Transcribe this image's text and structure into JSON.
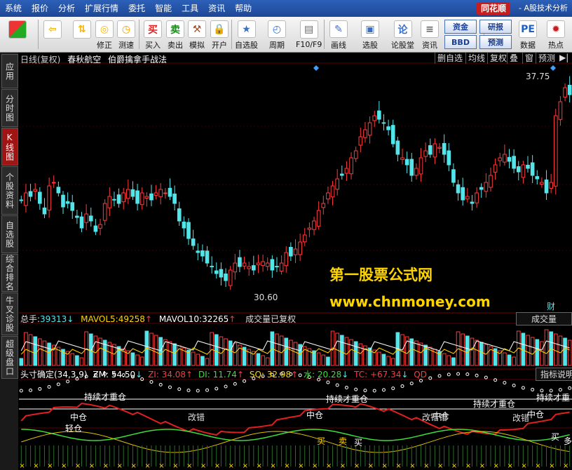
{
  "menubar": {
    "items": [
      "系统",
      "报价",
      "分析",
      "扩展行情",
      "委托",
      "智能",
      "工具",
      "资讯",
      "帮助"
    ],
    "brand": "同花顺",
    "subtitle": "- A股技术分析"
  },
  "toolbar": {
    "buttons": [
      {
        "label": "",
        "icon": "grid-icon"
      },
      {
        "label": "",
        "icon": "back-arrow-icon"
      },
      {
        "label": "",
        "icon": "up-down-icon"
      },
      {
        "label": "修正",
        "icon": "correction-icon"
      },
      {
        "label": "测速",
        "icon": "speed-test-icon"
      },
      {
        "label": "买入",
        "icon": "buy-icon",
        "glyph": "买"
      },
      {
        "label": "卖出",
        "icon": "sell-icon",
        "glyph": "卖"
      },
      {
        "label": "模拟",
        "icon": "simulate-icon"
      },
      {
        "label": "开户",
        "icon": "open-account-icon"
      },
      {
        "label": "自选股",
        "icon": "watchlist-icon"
      },
      {
        "label": "周期",
        "icon": "period-icon"
      },
      {
        "label": "F10/F9",
        "icon": "f10-icon"
      },
      {
        "label": "画线",
        "icon": "draw-line-icon"
      },
      {
        "label": "选股",
        "icon": "stock-picker-icon"
      },
      {
        "label": "论股堂",
        "icon": "forum-icon"
      },
      {
        "label": "资讯",
        "icon": "news-icon"
      },
      {
        "label": "数据",
        "icon": "data-icon"
      },
      {
        "label": "热点",
        "icon": "hotspot-icon"
      }
    ],
    "pills": [
      "资金",
      "研报",
      "BBD",
      "预测"
    ]
  },
  "sidebar": {
    "tabs": [
      "应用",
      "分时图",
      "K线图",
      "个股资料",
      "自选股",
      "综合排名",
      "牛叉诊股",
      "超级盘口"
    ]
  },
  "chart_header": {
    "title": "日线(复权)",
    "stock": "春秋航空",
    "method": "伯爵擒拿手战法",
    "right_buttons": [
      "删自选",
      "均线",
      "复权",
      "叠",
      "窗",
      "预测"
    ]
  },
  "price_chart": {
    "high_label": "37.75",
    "low_label": "30.60",
    "fin_badge": "财"
  },
  "volume_header": {
    "total_label": "总手:",
    "total_value": "39313",
    "mavol5_label": "MAVOL5:",
    "mavol5_value": "49258",
    "mavol10_label": "MAVOL10:",
    "mavol10_value": "32265",
    "note": "成交量已复权",
    "button": "成交量"
  },
  "indicator_header": {
    "name": "头寸确定(34,3,9)",
    "zm": "ZM: 54.50",
    "zi": "ZI: 34.08",
    "di": "DI: 11.74",
    "sq": "SQ: 32.98",
    "water": "水: 20.28",
    "tc": "TC: +67.34",
    "qd": "QD",
    "button": "指标说明"
  },
  "indicator_labels": [
    "持续才重仓",
    "持续才重仓",
    "持续才重仓",
    "持续才重",
    "中仓",
    "中仓",
    "中仓",
    "中仓",
    "改错",
    "改错错",
    "改错",
    "轻仓",
    "买",
    "买",
    "卖",
    "买",
    "多"
  ],
  "watermark": {
    "line1": "第一股票公式网",
    "line2": "www.chnmoney.com"
  },
  "colors": {
    "up": "#ff3b3b",
    "down": "#52e5ea",
    "accent_yellow": "#ffd500",
    "menubar": "#1d4796"
  },
  "chart_data": {
    "type": "candlestick",
    "high": 37.75,
    "low": 30.6,
    "volume": {
      "total": 39313,
      "mavol5": 49258,
      "mavol10": 32265
    },
    "indicator": {
      "zm": 54.5,
      "zi": 34.08,
      "di": 11.74,
      "sq": 32.98,
      "water": 20.28,
      "tc": 67.34
    }
  }
}
